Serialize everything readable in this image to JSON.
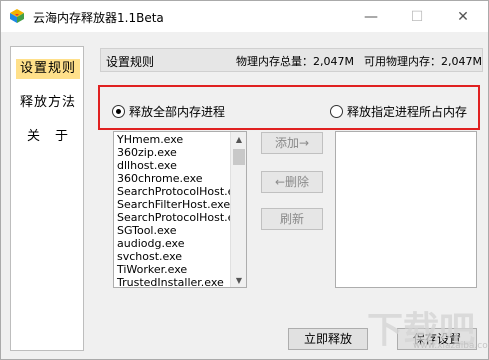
{
  "window": {
    "title": "云海内存释放器1.1Beta",
    "minimize_glyph": "—",
    "maximize_glyph": "☐",
    "close_glyph": "✕"
  },
  "sidebar": {
    "items": [
      {
        "label": "设置规则",
        "active": true
      },
      {
        "label": "释放方法",
        "active": false
      },
      {
        "label": "关　于",
        "active": false
      }
    ]
  },
  "header": {
    "title": "设置规则",
    "total_memory": "物理内存总量：2,047M",
    "available_memory": "可用物理内存：2,047M"
  },
  "mode": {
    "option_all": "释放全部内存进程",
    "option_specific": "释放指定进程所占内存",
    "selected": "all"
  },
  "process_list": {
    "items": [
      "YHmem.exe",
      "360zip.exe",
      "dllhost.exe",
      "360chrome.exe",
      "SearchProtocolHost.exe",
      "SearchFilterHost.exe",
      "SearchProtocolHost.exe",
      "SGTool.exe",
      "audiodg.exe",
      "svchost.exe",
      "TiWorker.exe",
      "TrustedInstaller.exe"
    ]
  },
  "buttons": {
    "add": "添加→",
    "delete": "←删除",
    "refresh": "刷新",
    "release_now": "立即释放",
    "save_settings": "保存设置"
  },
  "watermark": {
    "text": "下载吧",
    "subtext": "www.xiazaiba.com"
  }
}
